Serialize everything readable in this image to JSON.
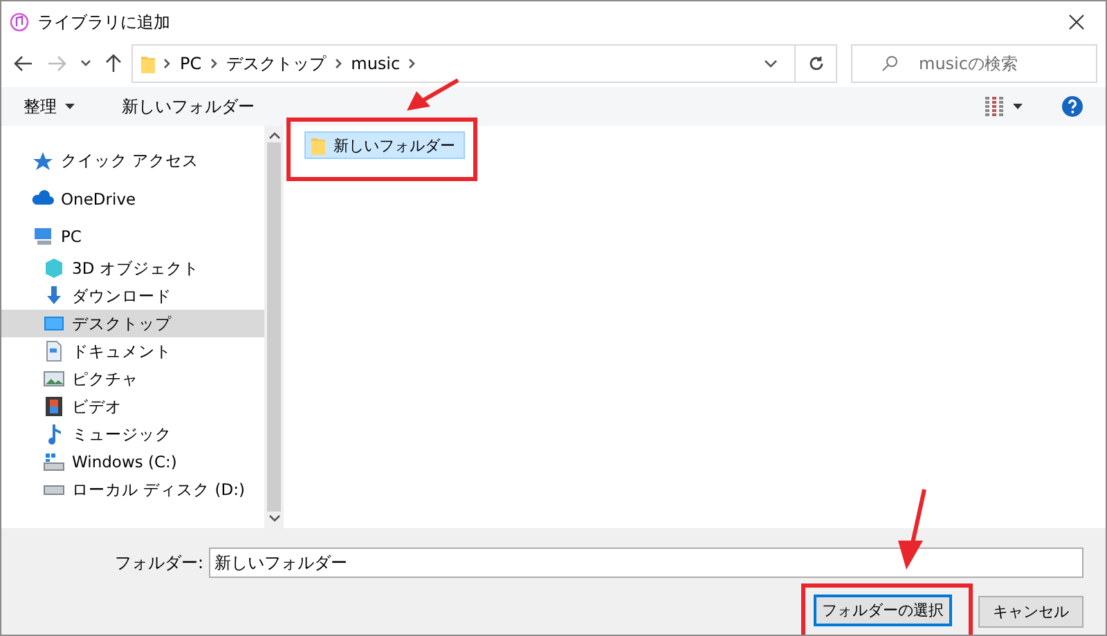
{
  "window": {
    "title": "ライブラリに追加"
  },
  "address_bar": {
    "segments": [
      "PC",
      "デスクトップ",
      "music"
    ]
  },
  "search": {
    "placeholder": "musicの検索"
  },
  "toolbar": {
    "organize": "整理",
    "new_folder": "新しいフォルダー"
  },
  "sidebar": {
    "items": [
      {
        "label": "クイック アクセス",
        "kind": "star",
        "selected": false
      },
      {
        "label": "OneDrive",
        "kind": "cloud",
        "selected": false
      },
      {
        "label": "PC",
        "kind": "computer",
        "selected": false,
        "children": [
          {
            "label": "3D オブジェクト",
            "kind": "cube",
            "selected": false
          },
          {
            "label": "ダウンロード",
            "kind": "download",
            "selected": false
          },
          {
            "label": "デスクトップ",
            "kind": "desktop",
            "selected": true
          },
          {
            "label": "ドキュメント",
            "kind": "document",
            "selected": false
          },
          {
            "label": "ピクチャ",
            "kind": "pictures",
            "selected": false
          },
          {
            "label": "ビデオ",
            "kind": "video",
            "selected": false
          },
          {
            "label": "ミュージック",
            "kind": "music",
            "selected": false
          },
          {
            "label": "Windows (C:)",
            "kind": "system_drive",
            "selected": false
          },
          {
            "label": "ローカル ディスク (D:)",
            "kind": "drive",
            "selected": false
          }
        ]
      }
    ]
  },
  "files": [
    {
      "name": "新しいフォルダー",
      "selected": true
    }
  ],
  "footer": {
    "folder_label": "フォルダー:",
    "folder_value": "新しいフォルダー",
    "buttons": [
      {
        "label": "フォルダーの選択",
        "default": true
      },
      {
        "label": "キャンセル",
        "default": false
      }
    ]
  }
}
